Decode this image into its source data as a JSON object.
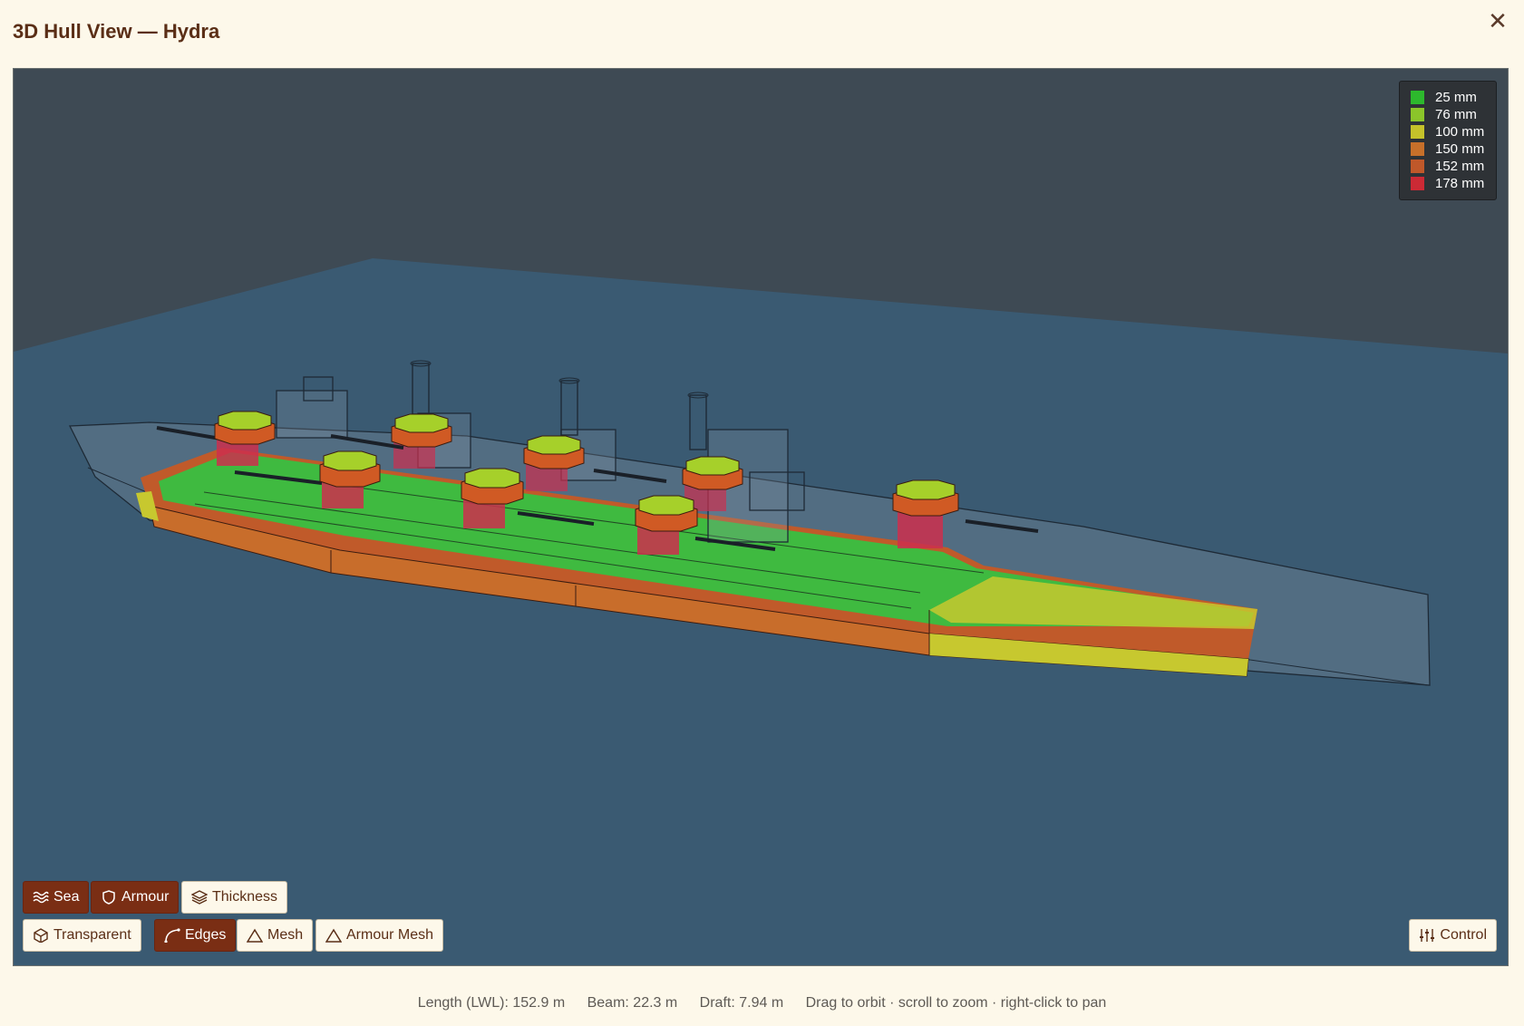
{
  "window": {
    "title": "3D Hull View — Hydra",
    "close_icon": "close-icon"
  },
  "legend": [
    {
      "label": "25 mm",
      "color": "#2db82d"
    },
    {
      "label": "76 mm",
      "color": "#8bc52a"
    },
    {
      "label": "100 mm",
      "color": "#c5c22a"
    },
    {
      "label": "150 mm",
      "color": "#c7702a"
    },
    {
      "label": "152 mm",
      "color": "#c0582a"
    },
    {
      "label": "178 mm",
      "color": "#cc2a35"
    }
  ],
  "toolbar_row1": [
    {
      "label": "Sea",
      "active": true,
      "icon": "waves-icon"
    },
    {
      "label": "Armour",
      "active": true,
      "icon": "shield-icon"
    },
    {
      "label": "Thickness",
      "active": false,
      "icon": "layers-icon"
    }
  ],
  "toolbar_row2": [
    {
      "label": "Transparent",
      "active": false,
      "icon": "cube-icon"
    },
    {
      "label": "Edges",
      "active": true,
      "icon": "curve-icon"
    },
    {
      "label": "Mesh",
      "active": false,
      "icon": "triangle-icon"
    },
    {
      "label": "Armour Mesh",
      "active": false,
      "icon": "triangle-icon"
    }
  ],
  "control_button": {
    "label": "Control",
    "icon": "sliders-icon"
  },
  "footer": {
    "length": "Length (LWL): 152.9 m",
    "beam": "Beam: 22.3 m",
    "draft": "Draft: 7.94 m",
    "hint": "Drag to orbit · scroll to zoom · right-click to pan"
  }
}
